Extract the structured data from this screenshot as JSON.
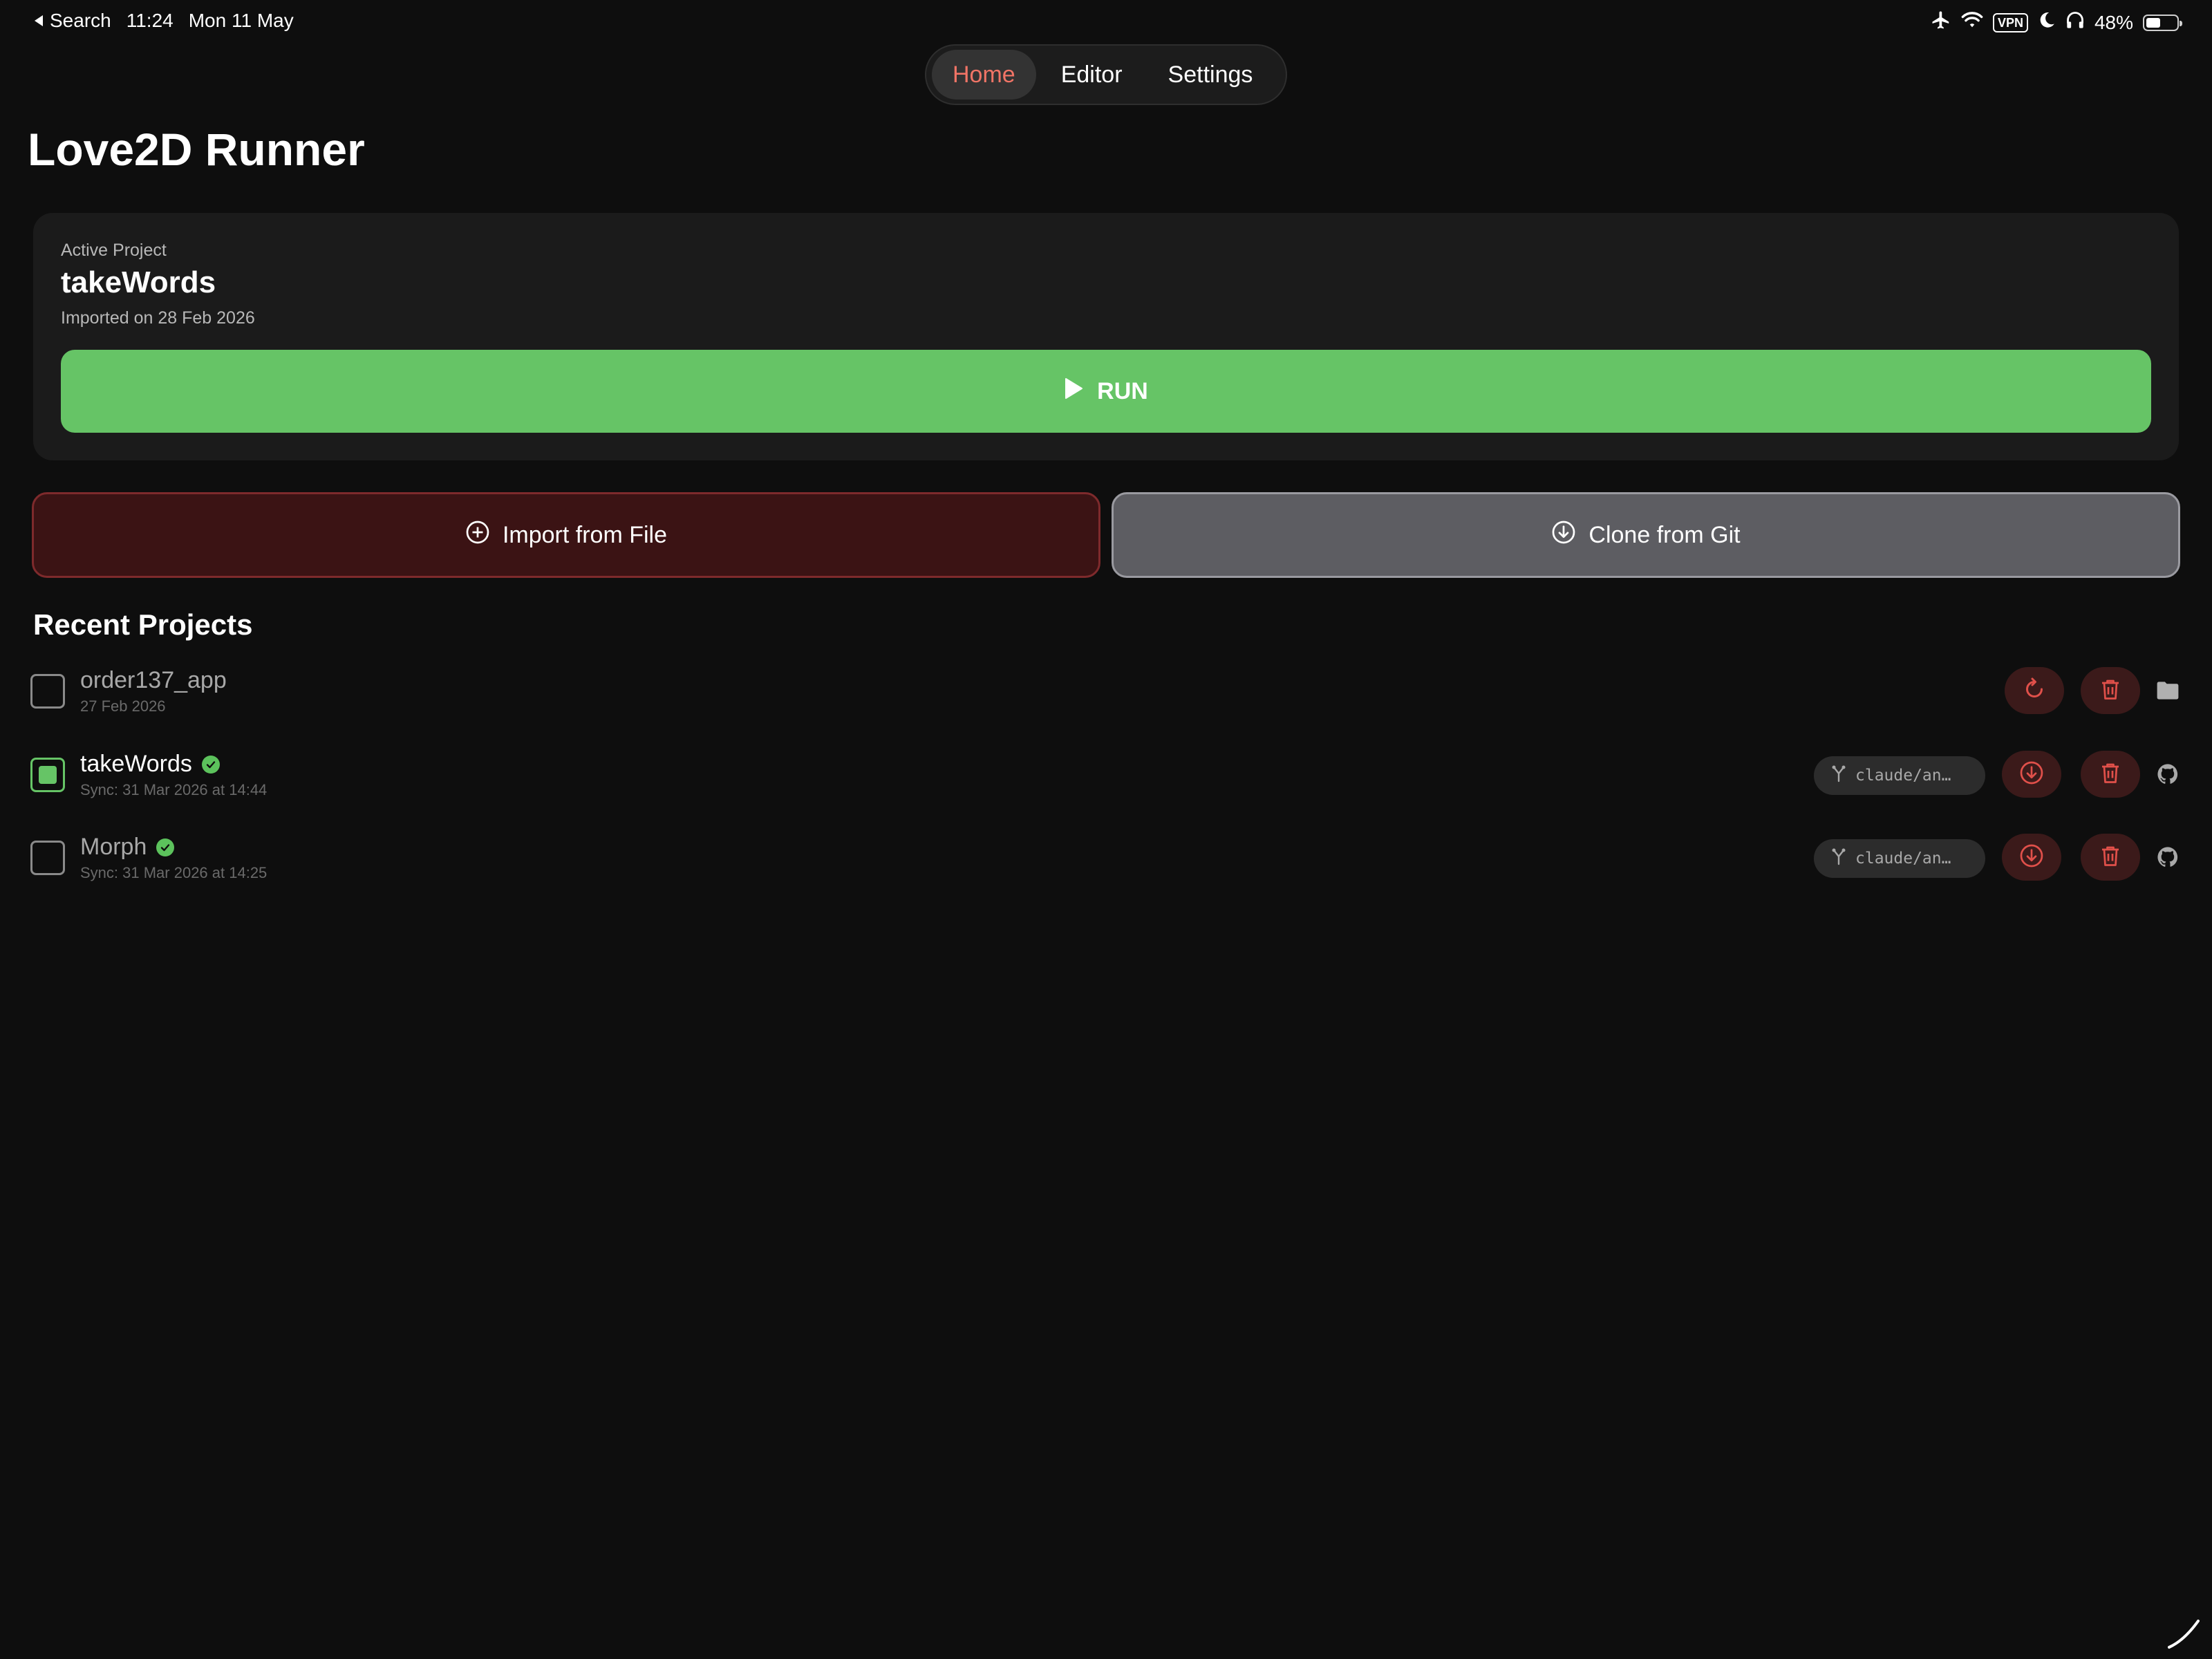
{
  "status_bar": {
    "back_label": "Search",
    "time": "11:24",
    "date": "Mon 11 May",
    "vpn": "VPN",
    "battery": "48%",
    "battery_level": 0.48
  },
  "tabs": [
    {
      "label": "Home",
      "active": true
    },
    {
      "label": "Editor",
      "active": false
    },
    {
      "label": "Settings",
      "active": false
    }
  ],
  "title": "Love2D Runner",
  "active_project": {
    "label": "Active Project",
    "name": "takeWords",
    "imported": "Imported on 28 Feb 2026",
    "run_label": "RUN"
  },
  "actions": {
    "import_label": "Import from File",
    "clone_label": "Clone from Git"
  },
  "recent": {
    "title": "Recent Projects",
    "items": [
      {
        "name": "order137_app",
        "sub": "27 Feb 2026",
        "checked": false,
        "synced": false,
        "branch": "",
        "source_icon": "folder-icon"
      },
      {
        "name": "takeWords",
        "sub": "Sync: 31 Mar 2026 at 14:44",
        "checked": true,
        "synced": true,
        "branch": "claude/an…",
        "source_icon": "github-icon"
      },
      {
        "name": "Morph",
        "sub": "Sync: 31 Mar 2026 at 14:25",
        "checked": false,
        "synced": true,
        "branch": "claude/an…",
        "source_icon": "github-icon"
      }
    ]
  },
  "colors": {
    "accent": "#f07466",
    "run_green": "#66c466",
    "danger": "#e0504a",
    "background": "#0e0e0e"
  }
}
